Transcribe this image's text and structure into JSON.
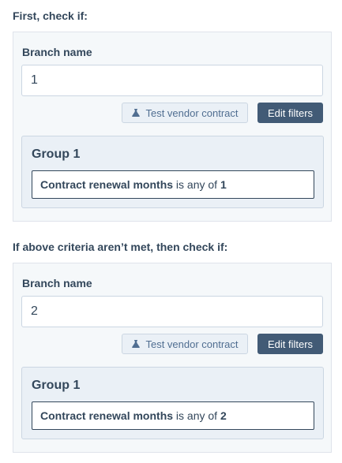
{
  "branches": [
    {
      "section_title": "First, check if:",
      "field_label": "Branch name",
      "name_value": "1",
      "test_button_label": "Test vendor contract",
      "edit_button_label": "Edit filters",
      "group": {
        "title": "Group 1",
        "filter": {
          "property": "Contract renewal months",
          "operator": "is any of",
          "value": "1"
        }
      }
    },
    {
      "section_title": "If above criteria aren’t met, then check if:",
      "field_label": "Branch name",
      "name_value": "2",
      "test_button_label": "Test vendor contract",
      "edit_button_label": "Edit filters",
      "group": {
        "title": "Group 1",
        "filter": {
          "property": "Contract renewal months",
          "operator": "is any of",
          "value": "2"
        }
      }
    }
  ],
  "icons": {
    "test_button": "flask-icon"
  },
  "colors": {
    "text": "#33475b",
    "card_bg": "#f5f8fa",
    "group_bg": "#eaf0f6",
    "primary_button": "#425b76",
    "secondary_text": "#506e91"
  }
}
